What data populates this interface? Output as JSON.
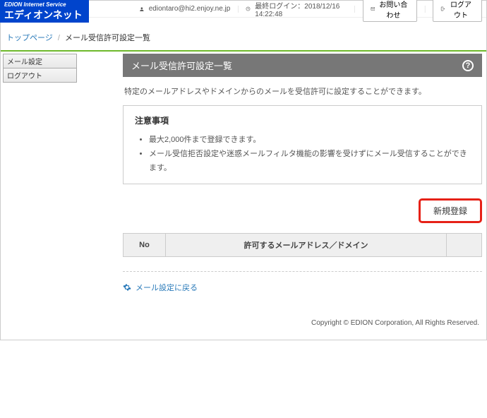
{
  "logo": {
    "line1": "EDION Internet Service",
    "line2": "エディオンネット"
  },
  "topbar": {
    "user_email": "ediontaro@hi2.enjoy.ne.jp",
    "last_login_label": "最終ログイン：2018/12/16　14:22:48",
    "contact_label": "お問い合わせ",
    "logout_label": "ログアウト"
  },
  "breadcrumb": {
    "top": "トップページ",
    "current": "メール受信許可設定一覧"
  },
  "sidebar": {
    "items": [
      {
        "label": "メール設定"
      },
      {
        "label": "ログアウト"
      }
    ]
  },
  "main": {
    "title": "メール受信許可設定一覧",
    "help_glyph": "?",
    "description": "特定のメールアドレスやドメインからのメールを受信許可に設定することができます。",
    "notice_title": "注意事項",
    "notices": [
      "最大2,000件まで登録できます。",
      "メール受信拒否設定や迷惑メールフィルタ機能の影響を受けずにメール受信することができます。"
    ],
    "new_button": "新規登録",
    "table": {
      "col_no": "No",
      "col_domain": "許可するメールアドレス／ドメイン"
    },
    "back_label": "メール設定に戻る"
  },
  "footer": {
    "copyright": "Copyright © EDION Corporation, All Rights Reserved."
  }
}
